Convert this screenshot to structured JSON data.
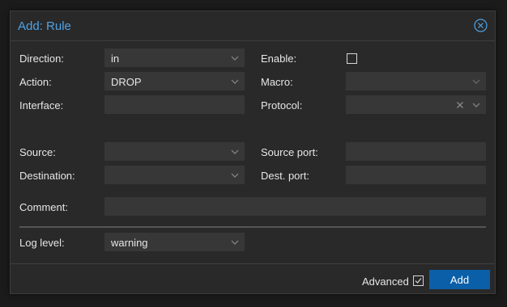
{
  "dialog": {
    "title": "Add: Rule"
  },
  "left": {
    "direction": {
      "label": "Direction:",
      "value": "in"
    },
    "action": {
      "label": "Action:",
      "value": "DROP"
    },
    "interface": {
      "label": "Interface:",
      "value": ""
    },
    "source": {
      "label": "Source:",
      "value": ""
    },
    "destination": {
      "label": "Destination:",
      "value": ""
    }
  },
  "right": {
    "enable": {
      "label": "Enable:",
      "checked": false
    },
    "macro": {
      "label": "Macro:",
      "value": ""
    },
    "protocol": {
      "label": "Protocol:",
      "value": ""
    },
    "source_port": {
      "label": "Source port:",
      "value": ""
    },
    "dest_port": {
      "label": "Dest. port:",
      "value": ""
    }
  },
  "comment": {
    "label": "Comment:",
    "value": ""
  },
  "log_level": {
    "label": "Log level:",
    "value": "warning"
  },
  "footer": {
    "advanced_label": "Advanced",
    "advanced_checked": true,
    "add_label": "Add"
  },
  "colors": {
    "title": "#4fa3e6",
    "button": "#0a5fa8",
    "field_bg": "#373737",
    "dialog_bg": "#292929"
  }
}
